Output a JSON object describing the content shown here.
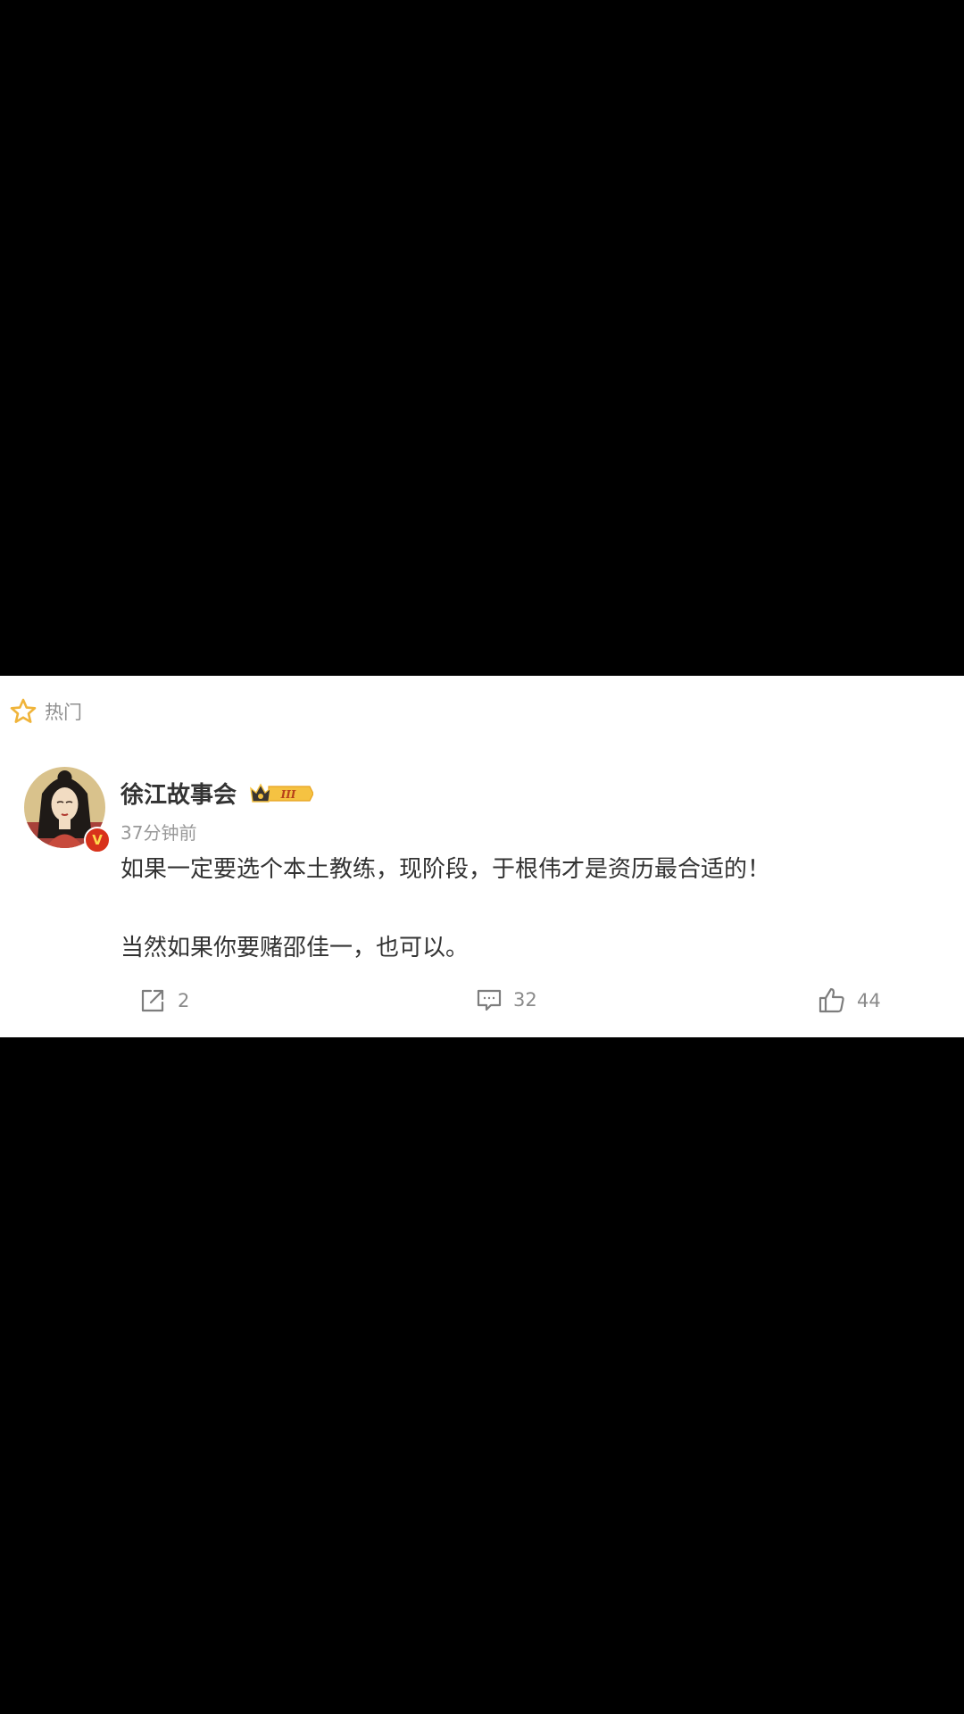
{
  "section": {
    "label": "热门",
    "accent_color": "#f0b43a"
  },
  "post": {
    "username": "徐江故事会",
    "level_badge": "III",
    "verified_badge": "V",
    "time": "37分钟前",
    "paragraphs": [
      "如果一定要选个本土教练，现阶段，于根伟才是资历最合适的！",
      "当然如果你要赌邵佳一，也可以。"
    ]
  },
  "actions": {
    "repost_count": "2",
    "comment_count": "32",
    "like_count": "44"
  },
  "icons": {
    "section": "star-icon",
    "repost": "share-icon",
    "comment": "comment-icon",
    "like": "thumbs-up-icon",
    "badge": "crown-icon"
  },
  "colors": {
    "text_primary": "#333333",
    "text_secondary": "#999999",
    "verified": "#d8321b",
    "badge_gold": "#f5c242"
  }
}
